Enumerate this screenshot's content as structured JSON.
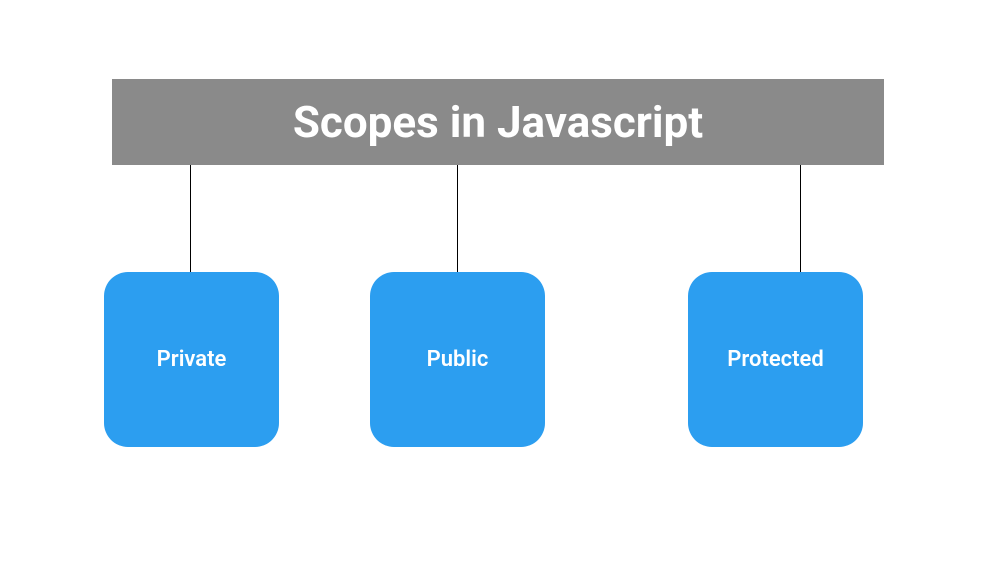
{
  "title": "Scopes in Javascript",
  "scopes": {
    "private": "Private",
    "public": "Public",
    "protected": "Protected"
  }
}
